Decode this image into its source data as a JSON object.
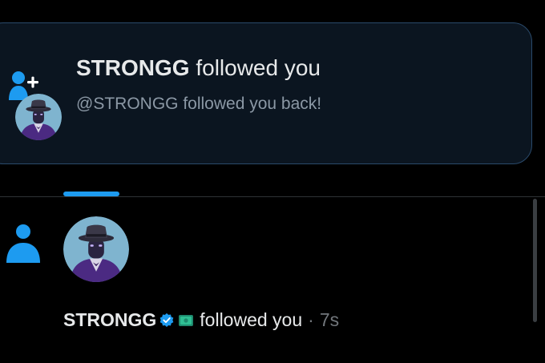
{
  "toast": {
    "name": "STRONGG",
    "action": "followed you",
    "subtitle": "@STRONGG followed you back!",
    "icon": "follow-person-plus-icon",
    "accent": "#1d9bf0"
  },
  "feed_item": {
    "name": "STRONGG",
    "action": "followed you",
    "separator": "·",
    "time": "7s",
    "icon": "person-icon",
    "verified_color": "#1d9bf0"
  },
  "colors": {
    "background": "#000000",
    "toast_background": "#0b1520",
    "toast_border": "#2a4a6b",
    "accent": "#1d9bf0"
  }
}
